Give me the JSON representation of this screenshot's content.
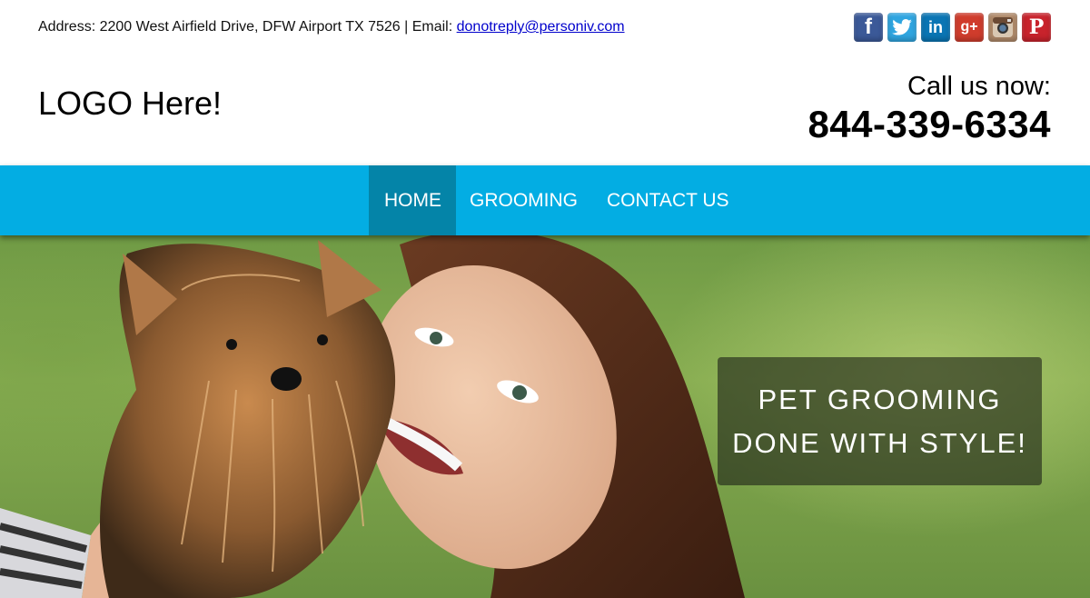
{
  "topbar": {
    "address_prefix": "Address: 2200 West Airfield Drive, DFW Airport TX 7526 | Email: ",
    "email": "donotreply@personiv.com"
  },
  "social": [
    {
      "name": "facebook",
      "glyph": "f"
    },
    {
      "name": "twitter",
      "glyph": ""
    },
    {
      "name": "linkedin",
      "glyph": "in"
    },
    {
      "name": "google-plus",
      "glyph": "g+"
    },
    {
      "name": "instagram",
      "glyph": ""
    },
    {
      "name": "pinterest",
      "glyph": "P"
    }
  ],
  "header": {
    "logo_text": "LOGO Here!",
    "call_label": "Call us now:",
    "phone": "844-339-6334"
  },
  "nav": {
    "items": [
      {
        "label": "HOME",
        "active": true
      },
      {
        "label": "GROOMING",
        "active": false
      },
      {
        "label": "CONTACT US",
        "active": false
      }
    ]
  },
  "hero": {
    "tagline_line1": "PET GROOMING",
    "tagline_line2": "DONE WITH STYLE!"
  },
  "colors": {
    "nav_background": "#03ade3",
    "nav_active": "#0484a8",
    "link": "#0000cc"
  }
}
